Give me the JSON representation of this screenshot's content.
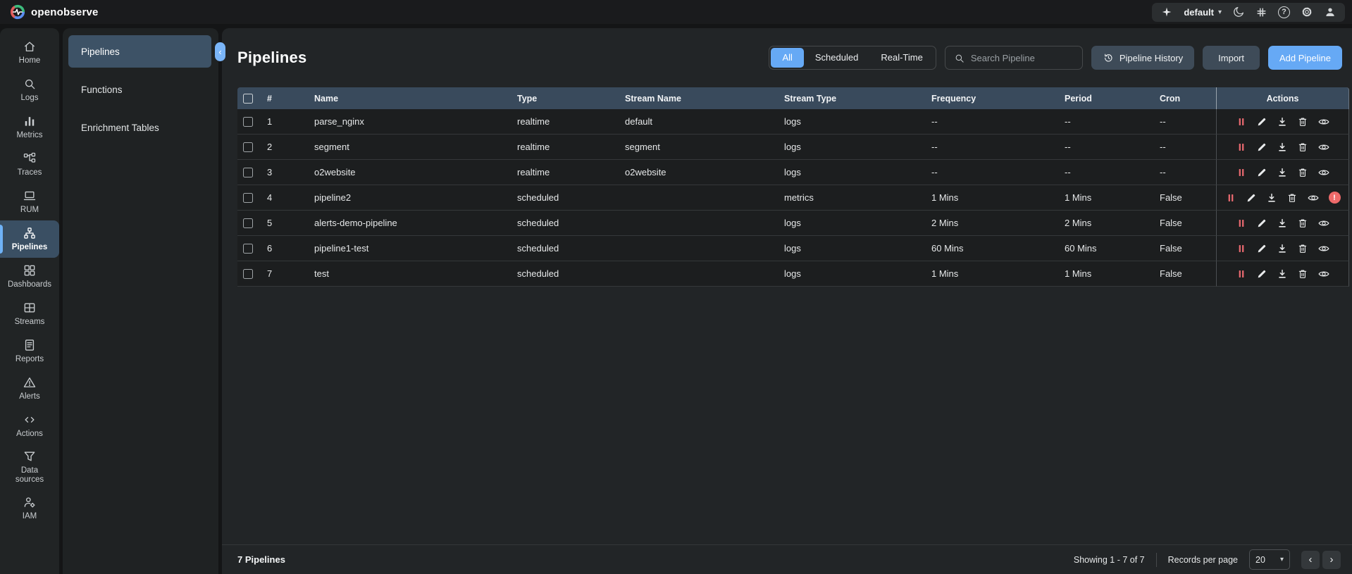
{
  "brand": {
    "name": "openobserve"
  },
  "topbar": {
    "org_selector": "default",
    "icons": [
      "sparkle",
      "dark-mode",
      "slack",
      "help",
      "settings",
      "account"
    ]
  },
  "rail": {
    "items": [
      {
        "label": "Home"
      },
      {
        "label": "Logs"
      },
      {
        "label": "Metrics"
      },
      {
        "label": "Traces"
      },
      {
        "label": "RUM"
      },
      {
        "label": "Pipelines",
        "active": true
      },
      {
        "label": "Dashboards"
      },
      {
        "label": "Streams"
      },
      {
        "label": "Reports"
      },
      {
        "label": "Alerts"
      },
      {
        "label": "Actions"
      },
      {
        "label": "Data sources"
      },
      {
        "label": "IAM"
      }
    ]
  },
  "subnav": {
    "items": [
      {
        "label": "Pipelines",
        "active": true
      },
      {
        "label": "Functions"
      },
      {
        "label": "Enrichment Tables"
      }
    ]
  },
  "page": {
    "title": "Pipelines"
  },
  "filter_tabs": [
    {
      "label": "All",
      "active": true
    },
    {
      "label": "Scheduled"
    },
    {
      "label": "Real-Time"
    }
  ],
  "search": {
    "placeholder": "Search Pipeline"
  },
  "buttons": {
    "history": "Pipeline History",
    "import": "Import",
    "add": "Add Pipeline"
  },
  "table": {
    "columns": [
      "#",
      "Name",
      "Type",
      "Stream Name",
      "Stream Type",
      "Frequency",
      "Period",
      "Cron",
      "Actions"
    ],
    "row_action_icons": [
      "pause",
      "edit",
      "download",
      "delete",
      "view"
    ],
    "rows": [
      {
        "num": "1",
        "name": "parse_nginx",
        "type": "realtime",
        "stream_name": "default",
        "stream_type": "logs",
        "frequency": "--",
        "period": "--",
        "cron": "--",
        "error": false
      },
      {
        "num": "2",
        "name": "segment",
        "type": "realtime",
        "stream_name": "segment",
        "stream_type": "logs",
        "frequency": "--",
        "period": "--",
        "cron": "--",
        "error": false
      },
      {
        "num": "3",
        "name": "o2website",
        "type": "realtime",
        "stream_name": "o2website",
        "stream_type": "logs",
        "frequency": "--",
        "period": "--",
        "cron": "--",
        "error": false
      },
      {
        "num": "4",
        "name": "pipeline2",
        "type": "scheduled",
        "stream_name": "",
        "stream_type": "metrics",
        "frequency": "1 Mins",
        "period": "1 Mins",
        "cron": "False",
        "error": true
      },
      {
        "num": "5",
        "name": "alerts-demo-pipeline",
        "type": "scheduled",
        "stream_name": "",
        "stream_type": "logs",
        "frequency": "2 Mins",
        "period": "2 Mins",
        "cron": "False",
        "error": false
      },
      {
        "num": "6",
        "name": "pipeline1-test",
        "type": "scheduled",
        "stream_name": "",
        "stream_type": "logs",
        "frequency": "60 Mins",
        "period": "60 Mins",
        "cron": "False",
        "error": false
      },
      {
        "num": "7",
        "name": "test",
        "type": "scheduled",
        "stream_name": "",
        "stream_type": "logs",
        "frequency": "1 Mins",
        "period": "1 Mins",
        "cron": "False",
        "error": false
      }
    ]
  },
  "footer": {
    "count": "7 Pipelines",
    "showing": "Showing 1 - 7 of 7",
    "records_label": "Records per page",
    "per_page": "20"
  },
  "colors": {
    "accent": "#66a9f5",
    "button_bg": "#3e4b58",
    "table_header_bg": "#394a5c",
    "selected_nav_bg": "#3d5266",
    "pause_icon": "#e8696f",
    "error_badge": "#ee6a6a"
  }
}
